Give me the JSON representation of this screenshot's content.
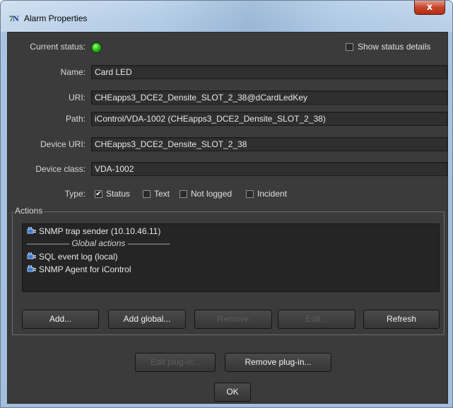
{
  "window": {
    "title": "Alarm Properties",
    "app_icon_letters": [
      "7",
      "N"
    ],
    "close_glyph": "x",
    "accent": "#a9c4e2"
  },
  "status": {
    "label": "Current status:",
    "led_color": "#2fbf1e",
    "show_details_label": "Show status details",
    "show_details_checked": false
  },
  "fields": {
    "name": {
      "label": "Name:",
      "value": "Card LED"
    },
    "uri": {
      "label": "URI:",
      "value": "CHEapps3_DCE2_Densite_SLOT_2_38@dCardLedKey"
    },
    "path": {
      "label": "Path:",
      "value": "iControl/VDA-1002 (CHEapps3_DCE2_Densite_SLOT_2_38)"
    },
    "device_uri": {
      "label": "Device URI:",
      "value": "CHEapps3_DCE2_Densite_SLOT_2_38"
    },
    "device_class": {
      "label": "Device class:",
      "value": "VDA-1002"
    }
  },
  "type": {
    "label": "Type:",
    "options": [
      {
        "label": "Status",
        "checked": true
      },
      {
        "label": "Text",
        "checked": false
      },
      {
        "label": "Not logged",
        "checked": false
      },
      {
        "label": "Incident",
        "checked": false
      }
    ]
  },
  "actions": {
    "legend": "Actions",
    "items": [
      {
        "label": "SNMP trap sender (10.10.46.11)",
        "icon": "plugin-icon"
      },
      {
        "label": "SQL event log (local)",
        "icon": "plugin-icon"
      },
      {
        "label": "SNMP Agent for iControl",
        "icon": "plugin-icon"
      }
    ],
    "global_separator": "————— Global actions —————",
    "buttons": {
      "add": "Add...",
      "add_global": "Add global...",
      "remove": "Remove",
      "edit": "Edit...",
      "refresh": "Refresh"
    }
  },
  "plugin_buttons": {
    "edit": "Edit plug-in...",
    "remove": "Remove plug-in..."
  },
  "ok_label": "OK"
}
